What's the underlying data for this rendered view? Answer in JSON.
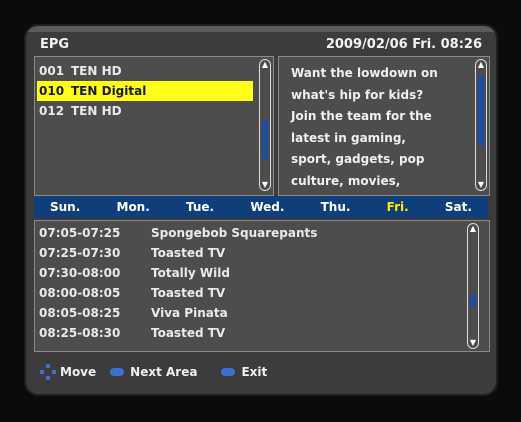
{
  "header": {
    "title": "EPG",
    "datetime": "2009/02/06  Fri.  08:26"
  },
  "channels": [
    {
      "num": "001",
      "name": "TEN HD",
      "selected": false
    },
    {
      "num": "010",
      "name": "TEN Digital",
      "selected": true
    },
    {
      "num": "012",
      "name": "TEN HD",
      "selected": false
    }
  ],
  "info": {
    "text": "Want the lowdown on\nwhat's hip for kids?\nJoin the team for the\nlatest in gaming,\nsport, gadgets, pop\nculture, movies,"
  },
  "days": [
    "Sun.",
    "Mon.",
    "Tue.",
    "Wed.",
    "Thu.",
    "Fri.",
    "Sat."
  ],
  "active_day": "Fri.",
  "schedule": [
    {
      "time": "07:05-07:25",
      "title": "Spongebob Squarepants"
    },
    {
      "time": "07:25-07:30",
      "title": "Toasted TV"
    },
    {
      "time": "07:30-08:00",
      "title": "Totally Wild"
    },
    {
      "time": "08:00-08:05",
      "title": "Toasted TV"
    },
    {
      "time": "08:05-08:25",
      "title": "Viva Pinata"
    },
    {
      "time": "08:25-08:30",
      "title": "Toasted TV"
    }
  ],
  "footer": {
    "move": "Move",
    "next_area": "Next Area",
    "exit": "Exit"
  },
  "colors": {
    "selected_bg": "#ffff1a",
    "day_bar": "#0f3f7a",
    "active_day": "#ffea00",
    "button": "#3d6fd1"
  },
  "icons": {
    "move": "dpad-icon",
    "next_area": "ok-button-icon",
    "exit": "exit-button-icon"
  }
}
